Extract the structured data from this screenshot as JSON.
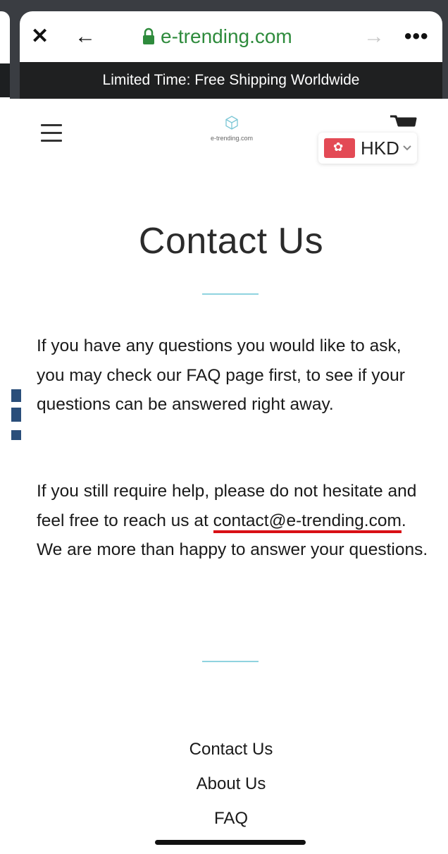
{
  "browser": {
    "close_symbol": "✕",
    "back_symbol": "←",
    "forward_symbol": "→",
    "more_symbol": "•••",
    "url": "e-trending.com"
  },
  "promo": {
    "text": "Limited Time: Free Shipping Worldwide"
  },
  "header": {
    "logo_text": "e-trending.com",
    "currency": {
      "code": "HKD",
      "flag": "hong-kong-flag-icon"
    }
  },
  "page": {
    "title": "Contact Us",
    "para1": "If you have any questions you would like to ask, you may check our FAQ page first, to see if your questions can be answered right away.",
    "para2_before": "If you still require help, please do not hesitate and feel free to reach us at ",
    "email": "contact@e-trending.com",
    "para2_after": ". We are more than happy to answer your questions."
  },
  "footer": {
    "links": [
      "Contact Us",
      "About Us",
      "FAQ"
    ]
  },
  "colors": {
    "url_green": "#2e8b3c",
    "promo_bg": "#1f2021",
    "divider": "#8fd3df",
    "underline_red": "#d90f15",
    "flag_red": "#e34a55"
  }
}
